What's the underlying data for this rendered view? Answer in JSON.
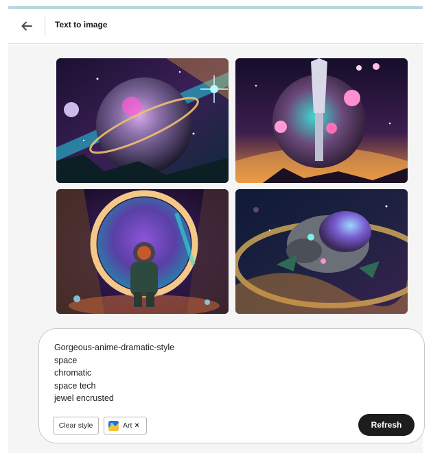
{
  "header": {
    "title": "Text to image",
    "back_icon": "arrow-left-icon"
  },
  "gallery": {
    "images": [
      {
        "id": "generated-image-1",
        "subject": "jeweled planet with cosmic rings"
      },
      {
        "id": "generated-image-2",
        "subject": "space tech sphere with glowing orbs"
      },
      {
        "id": "generated-image-3",
        "subject": "astronaut before a glowing portal"
      },
      {
        "id": "generated-image-4",
        "subject": "jewel-encrusted pod ship in space"
      }
    ]
  },
  "prompt": {
    "lines": [
      "Gorgeous-anime-dramatic-style",
      "space",
      "chromatic",
      "space tech",
      "jewel encrusted"
    ]
  },
  "controls": {
    "clear_style_label": "Clear style",
    "style_chip_label": "Art",
    "style_chip_remove": "×",
    "refresh_label": "Refresh"
  },
  "colors": {
    "accent_bar": "#b9d6dd",
    "canvas_bg": "#f5f5f5",
    "button_dark": "#1d1d1d"
  }
}
